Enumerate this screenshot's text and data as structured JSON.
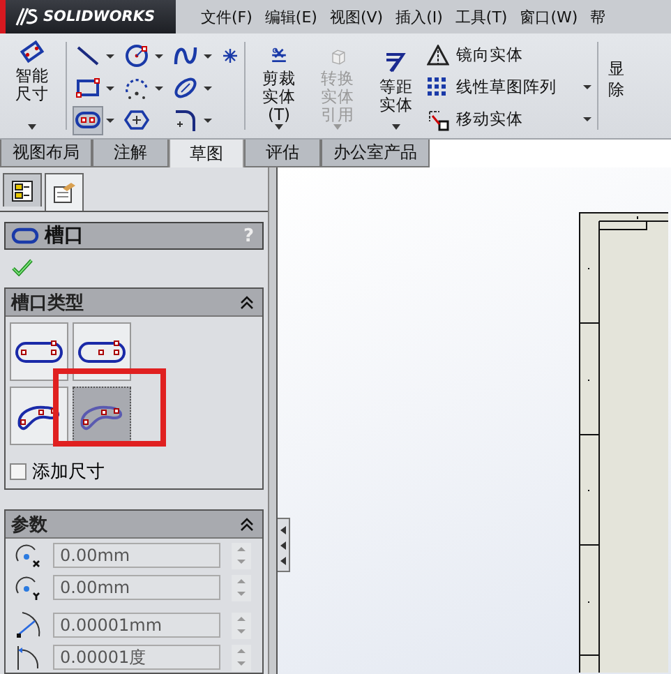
{
  "title_bar": {
    "brand": "SOLIDWORKS"
  },
  "menu": [
    "文件(F)",
    "编辑(E)",
    "视图(V)",
    "插入(I)",
    "工具(T)",
    "窗口(W)",
    "帮"
  ],
  "ribbon": {
    "smart_dimension": {
      "label": "智能尺寸"
    },
    "sketch_tools": [
      {
        "kind": "line",
        "selected": false,
        "dropdown": true
      },
      {
        "kind": "circle",
        "selected": false,
        "dropdown": true
      },
      {
        "kind": "spline",
        "selected": false,
        "dropdown": true
      },
      {
        "kind": "rectangle",
        "selected": false,
        "dropdown": true
      },
      {
        "kind": "arc",
        "selected": false,
        "dropdown": true
      },
      {
        "kind": "ellipse",
        "selected": false,
        "dropdown": true
      },
      {
        "kind": "slot",
        "selected": true,
        "dropdown": true
      },
      {
        "kind": "polygon",
        "selected": false,
        "dropdown": false
      },
      {
        "kind": "fillet",
        "selected": false,
        "dropdown": true
      }
    ],
    "big_tools": [
      {
        "kind": "trim",
        "label": "剪裁实体(T)",
        "disabled": false
      },
      {
        "kind": "convert",
        "label": "转换实体引用",
        "disabled": true
      },
      {
        "kind": "offset",
        "label": "等距实体",
        "disabled": false
      }
    ],
    "list_tools": [
      {
        "kind": "mirror",
        "label": "镜向实体",
        "dropdown": false
      },
      {
        "kind": "pattern",
        "label": "线性草图阵列",
        "dropdown": true
      },
      {
        "kind": "move",
        "label": "移动实体",
        "dropdown": true
      }
    ],
    "cut_button": {
      "lines": [
        "显",
        "除"
      ]
    }
  },
  "tabs": [
    {
      "label": "视图布局",
      "selected": false
    },
    {
      "label": "注解",
      "selected": false
    },
    {
      "label": "草图",
      "selected": true
    },
    {
      "label": "评估",
      "selected": false
    },
    {
      "label": "办公室产品",
      "selected": false
    }
  ],
  "panel": {
    "tabs": [
      {
        "kind": "feature_tree",
        "selected": false
      },
      {
        "kind": "property",
        "selected": true
      }
    ],
    "title": "槽口",
    "help": "?",
    "slot_type": {
      "title": "槽口类型",
      "expanded": true,
      "options": [
        {
          "kind": "straight",
          "selected": false
        },
        {
          "kind": "center_straight",
          "selected": false
        },
        {
          "kind": "arc",
          "selected": false
        },
        {
          "kind": "center_arc",
          "selected": true
        }
      ],
      "add_dimensions": {
        "label": "添加尺寸",
        "checked": false
      }
    },
    "parameters": {
      "title": "参数",
      "expanded": true,
      "fields": [
        {
          "kind": "center_x",
          "value": "0.00mm"
        },
        {
          "kind": "center_y",
          "value": "0.00mm"
        },
        {
          "kind": "radius",
          "value": "0.00001mm"
        },
        {
          "kind": "angle",
          "value": "0.00001度"
        }
      ]
    }
  }
}
